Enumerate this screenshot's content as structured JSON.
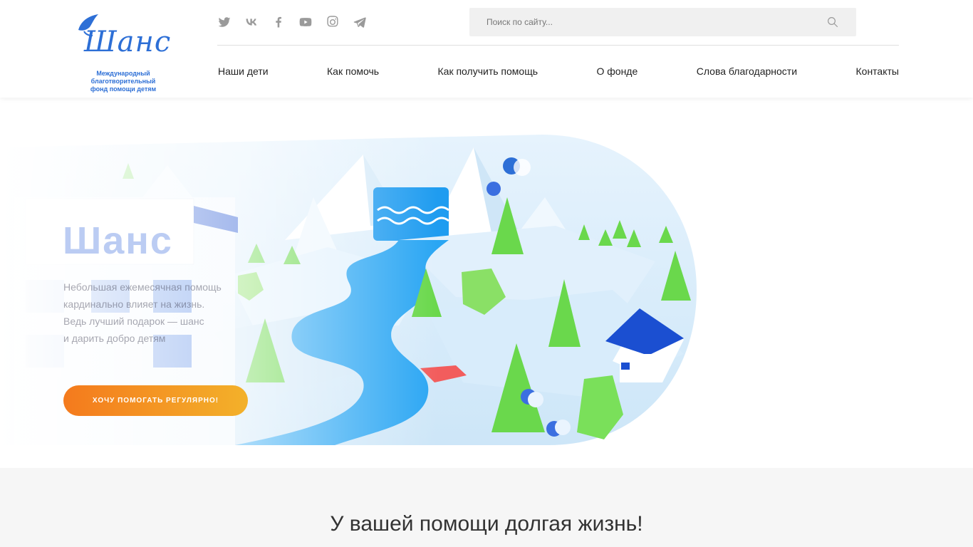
{
  "logo": {
    "script_text": "Шанс",
    "subtitle_line1": "Международный благотворительный",
    "subtitle_line2": "фонд помощи детям"
  },
  "socials": [
    {
      "icon": "twitter-icon"
    },
    {
      "icon": "vk-icon"
    },
    {
      "icon": "facebook-icon"
    },
    {
      "icon": "youtube-icon"
    },
    {
      "icon": "instagram-icon"
    },
    {
      "icon": "telegram-icon"
    }
  ],
  "search": {
    "placeholder": "Поиск по сайту..."
  },
  "nav": {
    "items": [
      {
        "label": "Наши дети"
      },
      {
        "label": "Как помочь"
      },
      {
        "label": "Как получить помощь"
      },
      {
        "label": "О фонде"
      },
      {
        "label": "Слова благодарности"
      },
      {
        "label": "Контакты"
      }
    ]
  },
  "hero": {
    "title": "Шанс",
    "text_line1": "Небольшая ежемесячная помощь",
    "text_line2": "кардинально влияет на жизнь.",
    "text_line3": "Ведь лучший подарок — шанс",
    "text_line4": "и дарить добро детям",
    "cta_label": "ХОЧУ ПОМОГАТЬ РЕГУЛЯРНО!"
  },
  "section2": {
    "heading": "У вашей помощи долгая жизнь!"
  },
  "colors": {
    "accent_blue": "#2d6fd6",
    "cta_start": "#f47a1d",
    "cta_end": "#f3b12a"
  }
}
